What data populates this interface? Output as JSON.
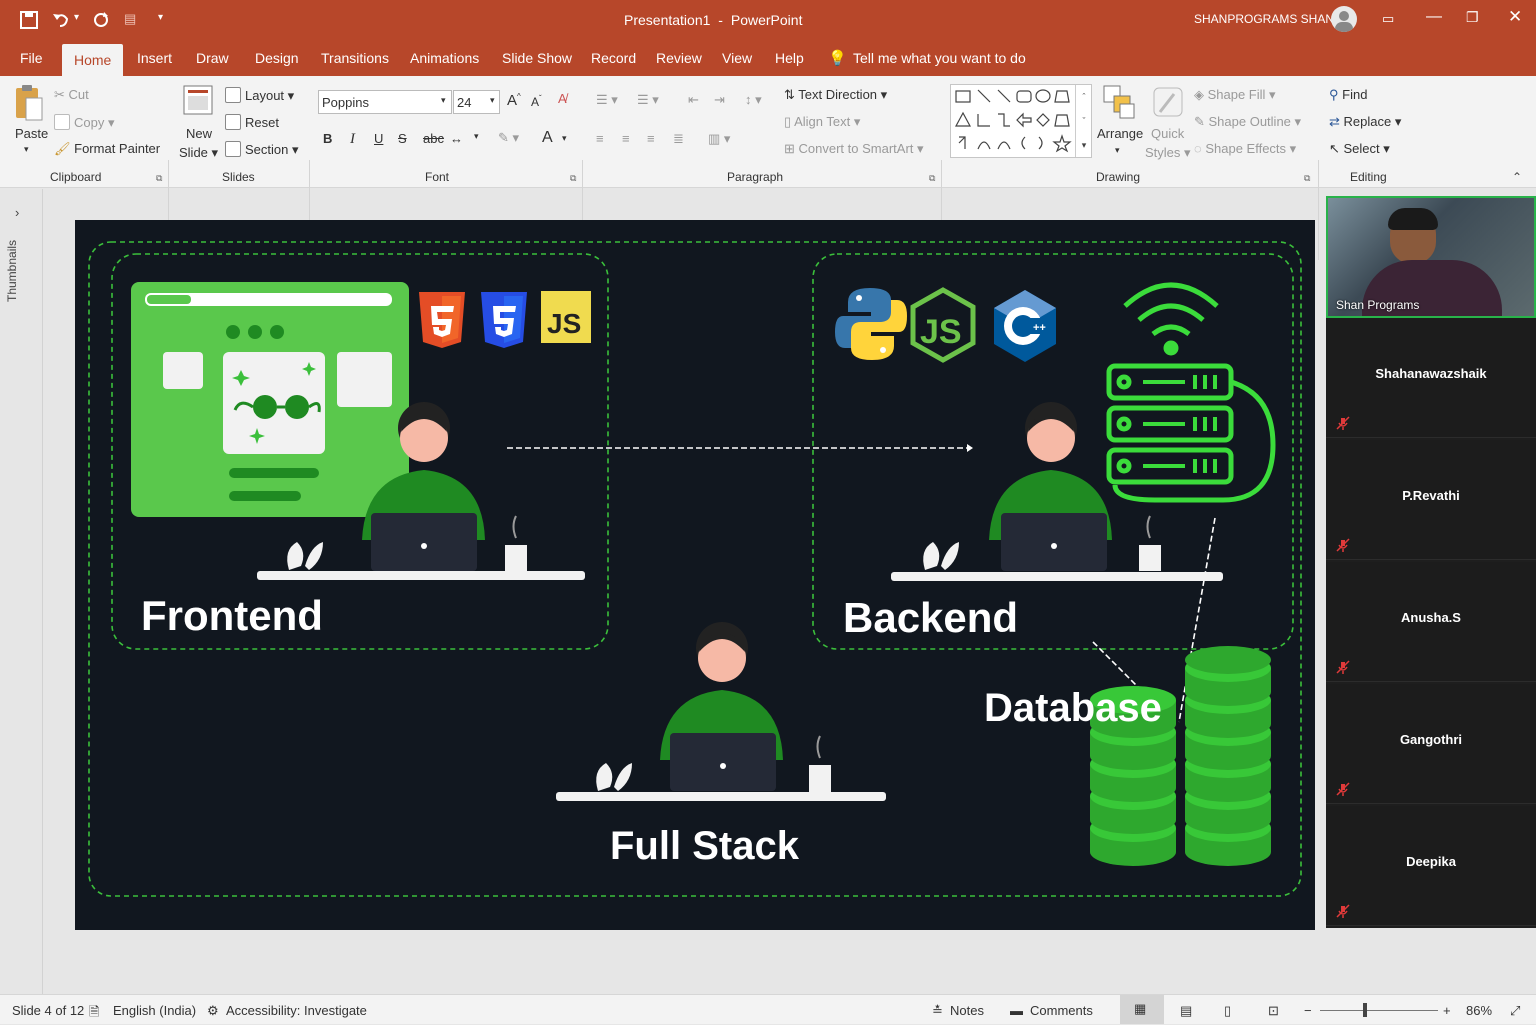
{
  "title_bar": {
    "document": "Presentation1",
    "separator": "-",
    "app": "PowerPoint",
    "user": "SHANPROGRAMS SHAN"
  },
  "tabs": [
    "File",
    "Home",
    "Insert",
    "Draw",
    "Design",
    "Transitions",
    "Animations",
    "Slide Show",
    "Record",
    "Review",
    "View",
    "Help"
  ],
  "tell_me": "Tell me what you want to do",
  "ribbon": {
    "clipboard": {
      "paste": "Paste",
      "cut": "Cut",
      "copy": "Copy",
      "format_painter": "Format Painter",
      "label": "Clipboard"
    },
    "slides": {
      "new_slide_1": "New",
      "new_slide_2": "Slide",
      "layout": "Layout",
      "reset": "Reset",
      "section": "Section",
      "label": "Slides"
    },
    "font": {
      "name": "Poppins",
      "size": "24",
      "bold": "B",
      "italic": "I",
      "underline": "U",
      "label": "Font"
    },
    "paragraph": {
      "text_direction": "Text Direction",
      "align_text": "Align Text",
      "smartart": "Convert to SmartArt",
      "label": "Paragraph"
    },
    "drawing": {
      "arrange": "Arrange",
      "quick_1": "Quick",
      "quick_2": "Styles",
      "shape_fill": "Shape Fill",
      "shape_outline": "Shape Outline",
      "shape_effects": "Shape Effects",
      "label": "Drawing"
    },
    "editing": {
      "find": "Find",
      "replace": "Replace",
      "select": "Select",
      "label": "Editing"
    }
  },
  "thumbnails_label": "Thumbnails",
  "slide": {
    "frontend": "Frontend",
    "backend": "Backend",
    "database": "Database",
    "fullstack": "Full Stack",
    "js_badge": "JS",
    "colors": {
      "bg": "#11171f",
      "accent": "#5ac84c",
      "dashed": "#3bbf3b",
      "shirt": "#1f8a22"
    }
  },
  "participants": {
    "host": "Shan Programs",
    "others": [
      "Shahanawazshaik",
      "P.Revathi",
      "Anusha.S",
      "Gangothri",
      "Deepika"
    ]
  },
  "status": {
    "slide": "Slide 4 of 12",
    "language": "English (India)",
    "accessibility": "Accessibility: Investigate",
    "notes": "Notes",
    "comments": "Comments",
    "zoom": "86%"
  }
}
